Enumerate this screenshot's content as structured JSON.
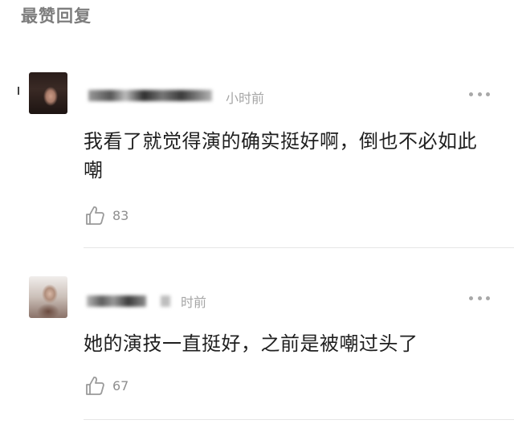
{
  "section": {
    "title": "最赞回复"
  },
  "comments": [
    {
      "time": "小时前",
      "text": "我看了就觉得演的确实挺好啊，倒也不必如此嘲",
      "likes": "83",
      "more_icon": "more-dots-icon",
      "like_icon": "thumbs-up-icon"
    },
    {
      "time": "时前",
      "text": "她的演技一直挺好，之前是被嘲过头了",
      "likes": "67",
      "more_icon": "more-dots-icon",
      "like_icon": "thumbs-up-icon"
    }
  ],
  "colors": {
    "title": "#7d7d7d",
    "meta": "#a6a6a6",
    "body": "#1f1f1f",
    "divider": "#e6e6e6"
  }
}
